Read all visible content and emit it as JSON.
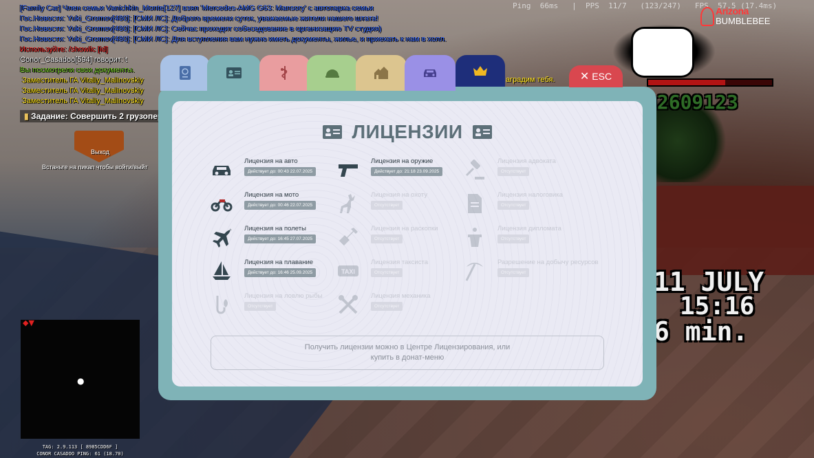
{
  "chat": [
    {
      "text": "[Family Car] Член семьи Vanichkin_Monte[127] взял 'Mercedes-AMG G63: Mansory' с автопарка семьи",
      "color": "blue"
    },
    {
      "text": "Гос.Новости: Yuki_Gromov[480]: [СМИ ЛС]: Доброго времени суток, уважаемые жители нашего штата!",
      "color": "blue"
    },
    {
      "text": "Гос.Новости: Yuki_Gromov[480]: [СМИ ЛС]: Сейчас проходит собеседование в организацию TV студия)",
      "color": "blue"
    },
    {
      "text": "Гос.Новости: Yuki_Gromov[480]: [СМИ ЛС]: Для вступления вам нужно иметь документы, жилье, и приехать к нам в холл.",
      "color": "blue"
    },
    {
      "text": "Используйте: /showlic [id]",
      "color": "red"
    },
    {
      "text": "Conor_Casadoo[594] говорит: t",
      "color": "white"
    },
    {
      "text": "Вы посмотрели свои документы.",
      "color": "green"
    },
    {
      "text": "Заместитель ГА Vitaliy_Malinovskiy",
      "color": "yellow"
    },
    {
      "text": "Заместитель ГА Vitaliy_Malinovskiy",
      "color": "yellow"
    },
    {
      "text": "Заместитель ГА Vitaliy_Malinovskiy",
      "color": "yellow"
    }
  ],
  "task": "Задание: Совершить 2 грузопере",
  "exit_sign": "Выход",
  "exit_hint": "Встаньте на пикап чтобы войти/выйт",
  "award_text": "аградим тебя.",
  "netstat": "Ping  66ms   |  PPS  11/7   (123/247)   FPS  57.5 (17.4ms)",
  "brand": {
    "top": "Arizona",
    "bottom": "BUMBLEBEE"
  },
  "hud": {
    "health": 0.62,
    "money": "02609123",
    "date": "11 JULY",
    "time": "15:16",
    "minutes": "6 min."
  },
  "minimap": {
    "tag_line": "TAG: 2.9.113 [ 8985CDD6F ]",
    "player_line": "CONOR CASADOO    PING: 61 (18.70)"
  },
  "tabs": [
    {
      "name": "passport",
      "color": "#a9c2e6",
      "icon": "passport-icon"
    },
    {
      "name": "licenses",
      "color": "#7fb3b7",
      "icon": "id-card-icon",
      "active": true
    },
    {
      "name": "medical",
      "color": "#e99d9f",
      "icon": "medical-icon"
    },
    {
      "name": "army",
      "color": "#a7cf8e",
      "icon": "helmet-icon"
    },
    {
      "name": "property",
      "color": "#dcc58f",
      "icon": "houses-icon"
    },
    {
      "name": "vehicles",
      "color": "#9a90e6",
      "icon": "car-icon"
    },
    {
      "name": "vip",
      "color": "#1e2e7a",
      "icon": "crown-icon"
    }
  ],
  "close_label": "ESC",
  "page_title": "ЛИЦЕНЗИИ",
  "licenses": [
    {
      "name": "Лицензия на авто",
      "status": "Действует до: 00:43 22.07.2025",
      "icon": "car-icon",
      "active": true
    },
    {
      "name": "Лицензия на мото",
      "status": "Действует до: 00:46 22.07.2025",
      "icon": "motorcycle-icon",
      "active": true
    },
    {
      "name": "Лицензия на полеты",
      "status": "Действует до: 16:45 27.07.2025",
      "icon": "airplane-icon",
      "active": true
    },
    {
      "name": "Лицензия на плавание",
      "status": "Действует до: 16:46 25.09.2025",
      "icon": "sailboat-icon",
      "active": true
    },
    {
      "name": "Лицензия на ловлю рыбы",
      "status": "Отсутствует",
      "icon": "fish-hook-icon",
      "active": false
    },
    {
      "name": "Лицензия на оружие",
      "status": "Действует до: 21:18 23.09.2025",
      "icon": "pistol-icon",
      "active": true
    },
    {
      "name": "Лицензия на охоту",
      "status": "Отсутствует",
      "icon": "deer-icon",
      "active": false
    },
    {
      "name": "Лицензия на раскопки",
      "status": "Отсутствует",
      "icon": "shovel-icon",
      "active": false
    },
    {
      "name": "Лицензия таксиста",
      "status": "Отсутствует",
      "icon": "taxi-icon",
      "active": false
    },
    {
      "name": "Лицензия механика",
      "status": "Отсутствует",
      "icon": "tools-icon",
      "active": false
    },
    {
      "name": "Лицензия адвоката",
      "status": "Отсутствует",
      "icon": "gavel-icon",
      "active": false
    },
    {
      "name": "Лицензия налоговика",
      "status": "Отсутствует",
      "icon": "tax-document-icon",
      "active": false
    },
    {
      "name": "Лицензия дипломата",
      "status": "Отсутствует",
      "icon": "podium-icon",
      "active": false
    },
    {
      "name": "Разрешение на добычу ресурсов",
      "status": "Отсутствует",
      "icon": "pickaxe-icon",
      "active": false
    }
  ],
  "info_text": "Получить лицензии можно в Центре Лицензирования, или купить в донат-меню"
}
